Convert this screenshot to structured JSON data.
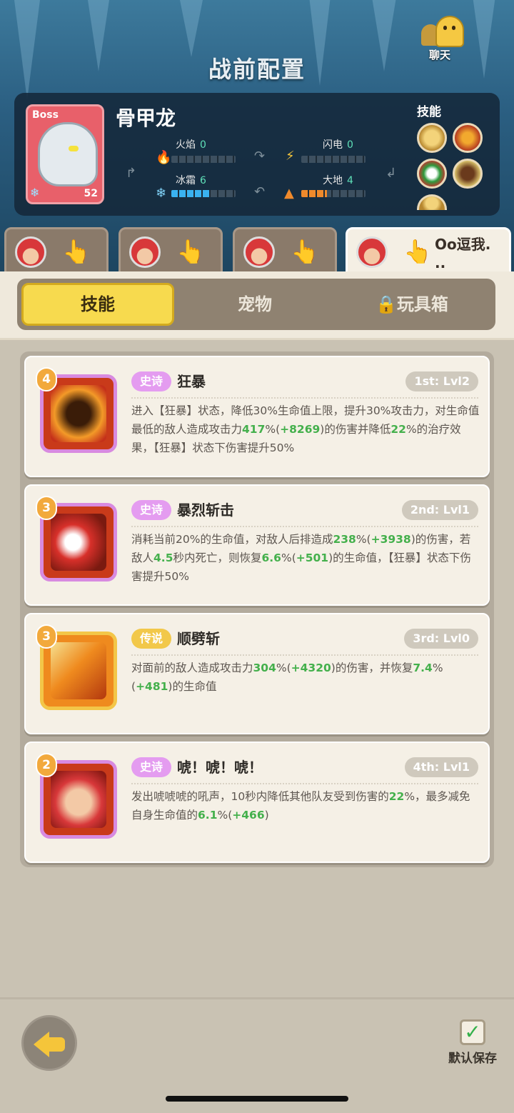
{
  "header": {
    "title": "战前配置",
    "chat_label": "聊天"
  },
  "boss": {
    "tag": "Boss",
    "name": "骨甲龙",
    "level": "52",
    "elements": [
      {
        "name": "火焰",
        "value": "0",
        "fill": 0
      },
      {
        "name": "闪电",
        "value": "0",
        "fill": 0
      },
      {
        "name": "冰霜",
        "value": "6",
        "fill": 0.6
      },
      {
        "name": "大地",
        "value": "4",
        "fill": 0.4
      }
    ],
    "skills_label": "技能"
  },
  "heroes": [
    {
      "name": ""
    },
    {
      "name": ""
    },
    {
      "name": ""
    },
    {
      "name": "Oo逗我.\n.."
    }
  ],
  "tabs": {
    "skills": "技能",
    "pets": "宠物",
    "toybox": "玩具箱"
  },
  "skills": [
    {
      "level_badge": "4",
      "rarity": "史诗",
      "name": "狂暴",
      "rank": "1st: Lvl2"
    },
    {
      "level_badge": "3",
      "rarity": "史诗",
      "name": "暴烈斩击",
      "rank": "2nd: Lvl1"
    },
    {
      "level_badge": "3",
      "rarity": "传说",
      "name": "顺劈斩",
      "rank": "3rd: Lvl0"
    },
    {
      "level_badge": "2",
      "rarity": "史诗",
      "name": "唬！唬！唬！",
      "rank": "4th: Lvl1"
    }
  ],
  "desc": {
    "s1": {
      "a": "进入【狂暴】状态，降低30%生命值上限，提升30%攻击力，对生命值最低的敌人造成攻击力",
      "b": "417",
      "c": "%(",
      "d": "+8269",
      "e": ")的伤害并降低",
      "f": "22",
      "g": "%的治疗效果，【狂暴】状态下伤害提升50%"
    },
    "s2": {
      "a": "消耗当前20%的生命值，对敌人后排造成",
      "b": "238",
      "c": "%(",
      "d": "+3938",
      "e": ")的伤害，若敌人",
      "f": "4.5",
      "g": "秒内死亡，则恢复",
      "h": "6.6",
      "i": "%(",
      "j": "+501",
      "k": ")的生命值，【狂暴】状态下伤害提升50%"
    },
    "s3": {
      "a": "对面前的敌人造成攻击力",
      "b": "304",
      "c": "%(",
      "d": "+4320",
      "e": ")的伤害，并恢复",
      "f": "7.4",
      "g": "%(",
      "h": "+481",
      "i": ")的生命值"
    },
    "s4": {
      "a": "发出唬唬唬的吼声，10秒内降低其他队友受到伤害的",
      "b": "22",
      "c": "%，最多减免自身生命值的",
      "d": "6.1",
      "e": "%(",
      "f": "+466",
      "g": ")"
    }
  },
  "footer": {
    "save_label": "默认保存"
  }
}
